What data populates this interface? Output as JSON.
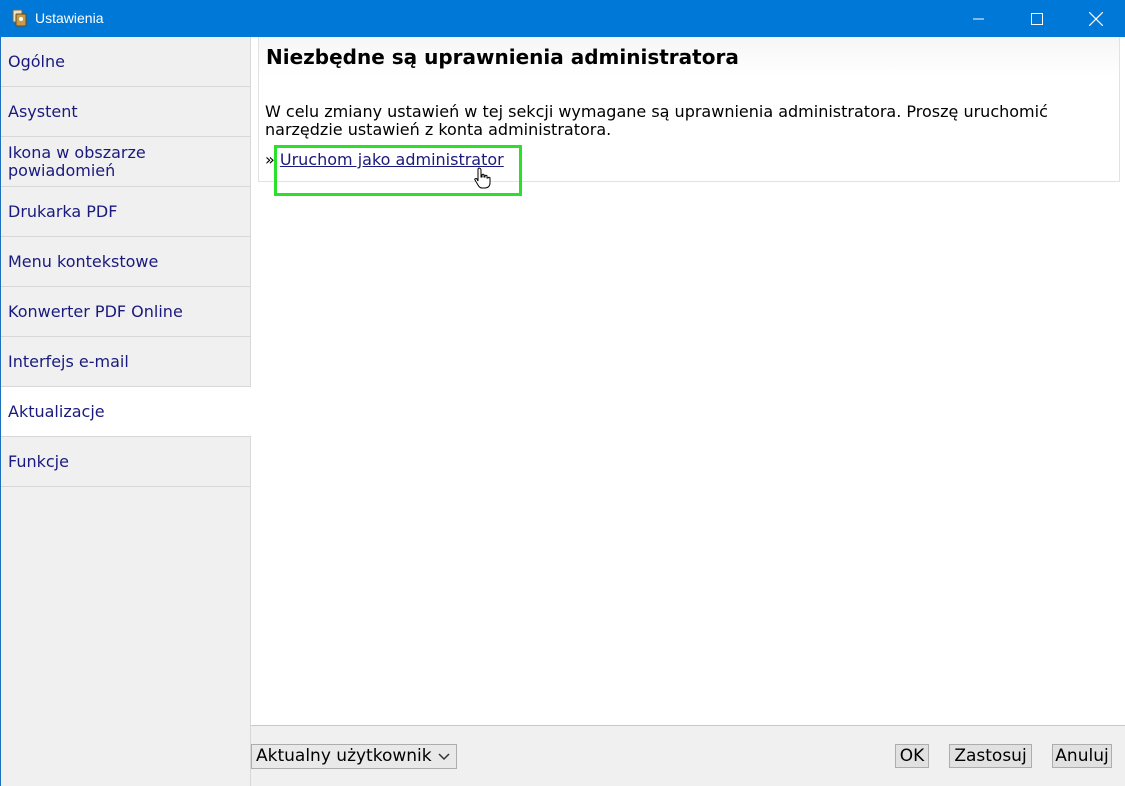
{
  "window": {
    "title": "Ustawienia"
  },
  "sidebar": {
    "items": [
      {
        "label": "Ogólne"
      },
      {
        "label": "Asystent"
      },
      {
        "label": "Ikona w obszarze\npowiadomień"
      },
      {
        "label": "Drukarka PDF"
      },
      {
        "label": "Menu kontekstowe"
      },
      {
        "label": "Konwerter PDF Online"
      },
      {
        "label": "Interfejs e-mail"
      },
      {
        "label": "Aktualizacje"
      },
      {
        "label": "Funkcje"
      }
    ],
    "active": "Aktualizacje"
  },
  "main": {
    "title": "Niezbędne są uprawnienia administratora",
    "description": "W celu zmiany ustawień w tej sekcji wymagane są uprawnienia administratora. Proszę uruchomić narzędzie ustawień z konta administratora.",
    "link_prefix": "»",
    "link_label": "Uruchom jako administrator"
  },
  "footer": {
    "user_select_value": "Aktualny użytkownik",
    "ok_label": "OK",
    "apply_label": "Zastosuj",
    "cancel_label": "Anuluj"
  },
  "colors": {
    "titlebar": "#0078d7",
    "link": "#1a1a7e",
    "highlight": "#2be02b"
  }
}
